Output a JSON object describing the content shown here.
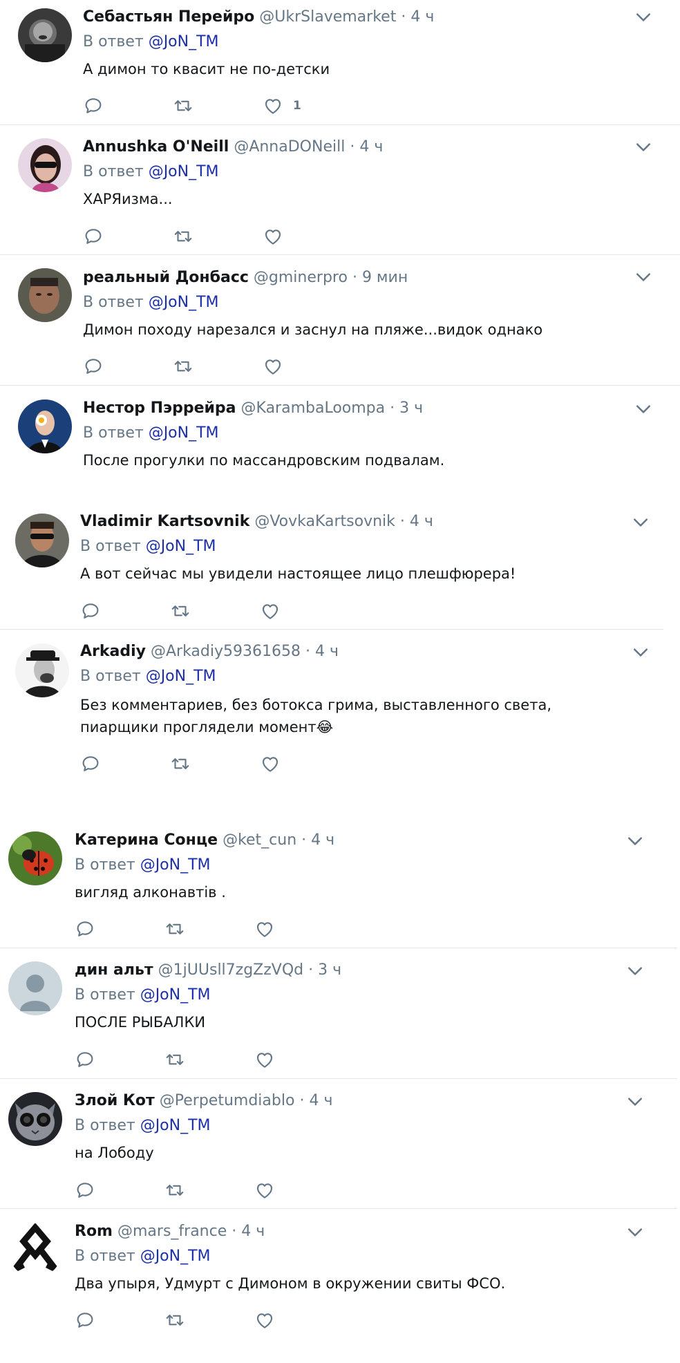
{
  "tweets": [
    {
      "name": "Себастьян Перейро",
      "handle": "@UkrSlavemarket",
      "time": "4 ч",
      "reply_prefix": "В ответ",
      "mention": "@JoN_TM",
      "text": "А димон то квасит не по-детски",
      "like_count": "1"
    },
    {
      "name": "Annushka O'Neill",
      "handle": "@AnnaDONeill",
      "time": "4 ч",
      "reply_prefix": "В ответ",
      "mention": "@JoN_TM",
      "text": "ХАРЯизма...",
      "like_count": ""
    },
    {
      "name": "реальный Донбасс",
      "handle": "@gminerpro",
      "time": "9 мин",
      "reply_prefix": "В ответ",
      "mention": "@JoN_TM",
      "text": "Димон походу нарезался и заснул на пляже...видок однако",
      "like_count": ""
    },
    {
      "name": "Нестор Пэррейра",
      "handle": "@KarambaLoompa",
      "time": "3 ч",
      "reply_prefix": "В ответ",
      "mention": "@JoN_TM",
      "text": "После прогулки по массандровским подвалам.",
      "like_count": ""
    },
    {
      "name": "Vladimir Kartsovnik",
      "handle": "@VovkaKartsovnik",
      "time": "4 ч",
      "reply_prefix": "В ответ",
      "mention": "@JoN_TM",
      "text": "А вот сейчас мы увидели настоящее лицо плешфюрера!",
      "like_count": ""
    },
    {
      "name": "Arkadiy",
      "handle": "@Arkadiy59361658",
      "time": "4 ч",
      "reply_prefix": "В ответ",
      "mention": "@JoN_TM",
      "text": "Без комментариев, без ботокса грима, выставленного света, пиарщики проглядели момент😂",
      "like_count": ""
    },
    {
      "name": "Катерина Сонце",
      "handle": "@ket_cun",
      "time": "4 ч",
      "reply_prefix": "В ответ",
      "mention": "@JoN_TM",
      "text": "вигляд алконавтів .",
      "like_count": ""
    },
    {
      "name": "дин альт",
      "handle": "@1jUUsll7zgZzVQd",
      "time": "3 ч",
      "reply_prefix": "В ответ",
      "mention": "@JoN_TM",
      "text": "ПОСЛЕ РЫБАЛКИ",
      "like_count": ""
    },
    {
      "name": "Злой Кот",
      "handle": "@Perpetumdiablo",
      "time": "4 ч",
      "reply_prefix": "В ответ",
      "mention": "@JoN_TM",
      "text": "на Лободу",
      "like_count": ""
    },
    {
      "name": "Rom",
      "handle": "@mars_france",
      "time": "4 ч",
      "reply_prefix": "В ответ",
      "mention": "@JoN_TM",
      "text": "Два упыря, Удмурт с Димоном в окружении свиты ФСО.",
      "like_count": ""
    }
  ],
  "ui": {
    "dot": "·",
    "colors": {
      "text": "#14171a",
      "secondary": "#657786",
      "mention": "#1b2fa8",
      "divider": "#e1e8ed"
    },
    "icons": [
      "reply-icon",
      "retweet-icon",
      "like-icon",
      "chevron-down-icon"
    ]
  }
}
